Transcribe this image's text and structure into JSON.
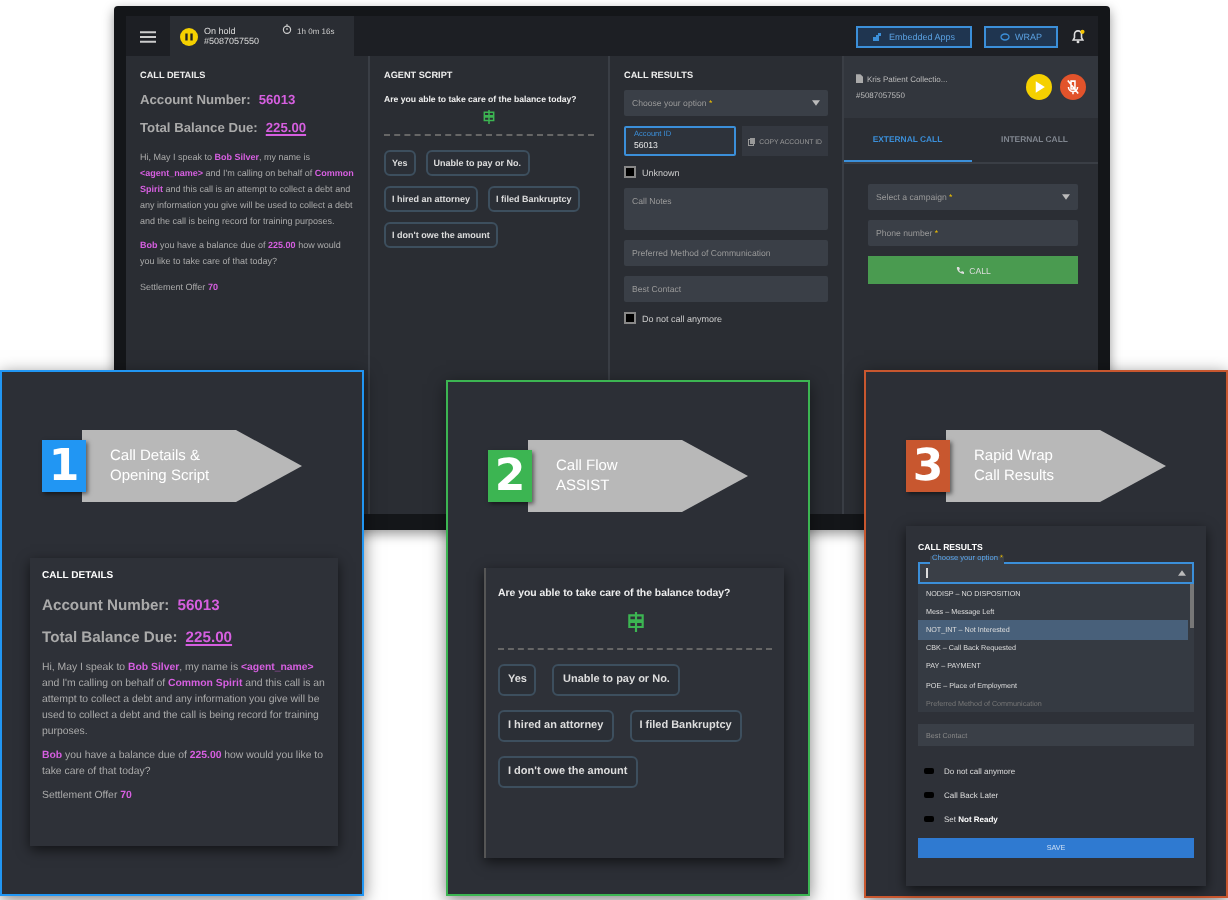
{
  "monitor": {
    "topbar": {
      "status": "On hold",
      "number": "#5087057550",
      "timer": "1h 0m 16s",
      "buttons": [
        {
          "label": "Embedded Apps",
          "kind": "apps"
        },
        {
          "label": "WRAP",
          "kind": "wrap"
        }
      ]
    },
    "call_details": {
      "heading": "CALL DETAILS",
      "account_label": "Account Number:",
      "account_value": "56013",
      "balance_label": "Total Balance Due:",
      "balance_value": "225.00",
      "paragraphs": [
        "Hi, May I speak to **Bob Silver**, my name is **<agent_name>** and I'm calling on behalf of **Common Spirit** and this call is an attempt to collect a debt and any information you give will be used to collect a debt and the call is being record for training purposes.",
        "**Bob** you have a balance due of **225.00** how would you like to take care of that today?"
      ],
      "offer": "Settlement Offer **70**"
    },
    "agent_script": {
      "heading": "AGENT SCRIPT",
      "question": "Are you able to take care of the balance today?",
      "answers": [
        "Yes",
        "Unable to pay or No.",
        "I hired an attorney",
        "I filed Bankruptcy",
        "I don't owe the amount"
      ]
    },
    "call_results": {
      "heading": "CALL RESULTS",
      "select": {
        "placeholder": "Choose your option",
        "required": "*"
      },
      "account_field": {
        "label": "Account ID",
        "value": "56013"
      },
      "copy_button": "COPY ACCOUNT ID",
      "unknown": {
        "label": "Unknown",
        "checked": false
      },
      "notes": {
        "placeholder": "Call Notes"
      },
      "preferred": {
        "placeholder": "Preferred Method of Communication"
      },
      "best_contact": {
        "placeholder": "Best Contact"
      },
      "dnc": {
        "label": "Do not call anymore",
        "checked": false
      }
    },
    "dialer": {
      "caller": "Kris Patient Collectio...",
      "number": "#5087057550",
      "tabs": [
        {
          "label": "EXTERNAL CALL",
          "selected": true
        },
        {
          "label": "INTERNAL CALL",
          "selected": false
        }
      ],
      "campaign": {
        "placeholder": "Select a campaign",
        "required": "*"
      },
      "phone": {
        "placeholder": "Phone number",
        "required": "*"
      },
      "call_button": "CALL"
    }
  },
  "callouts": [
    {
      "kind": "details",
      "number": "1",
      "title": [
        "Call Details &",
        "Opening Script"
      ],
      "color": "#2196f3",
      "call_details": {
        "heading": "CALL DETAILS",
        "account_label": "Account Number:",
        "account_value": "56013",
        "balance_label": "Total Balance Due:",
        "balance_value": "225.00",
        "paragraphs": [
          "Hi, May I speak to **Bob Silver**, my name is **<agent_name>** and I'm calling on behalf of **Common Spirit** and this call is an attempt to collect a debt and any information you give will be used to collect a debt and the call is being record for training purposes.",
          "**Bob** you have a balance due of **225.00** how would you like to take care of that today?"
        ],
        "offer": "Settlement Offer **70**"
      }
    },
    {
      "kind": "script",
      "number": "2",
      "title": [
        "Call Flow",
        "ASSIST"
      ],
      "color": "#3cb552",
      "agent_script": {
        "question": "Are you able to take care of the balance today?",
        "answers": [
          "Yes",
          "Unable to pay or No.",
          "I hired an attorney",
          "I filed Bankruptcy",
          "I don't owe the amount"
        ]
      }
    },
    {
      "kind": "results",
      "number": "3",
      "title": [
        "Rapid Wrap",
        "Call Results"
      ],
      "color": "#c8572f",
      "call_results": {
        "heading": "CALL RESULTS",
        "select": {
          "label": "Choose your option",
          "required": "*"
        },
        "options": [
          {
            "label": "NODISP – NO DISPOSITION",
            "selected": false
          },
          {
            "label": "Mess – Message Left",
            "selected": false
          },
          {
            "label": "NOT_INT – Not Interested",
            "selected": true
          },
          {
            "label": "CBK – Call Back Requested",
            "selected": false
          },
          {
            "label": "PAY – PAYMENT",
            "selected": false
          },
          {
            "label": "POE – Place of Employment",
            "selected": false
          }
        ],
        "hidden_field": "Preferred Method of Communication",
        "best_contact": {
          "placeholder": "Best Contact"
        },
        "checkboxes": [
          {
            "label": "Do not call anymore",
            "checked": false
          },
          {
            "label": "Call Back Later",
            "checked": false
          },
          {
            "label": "Set **Not Ready**",
            "checked": false
          }
        ],
        "save_button": "SAVE"
      }
    }
  ]
}
